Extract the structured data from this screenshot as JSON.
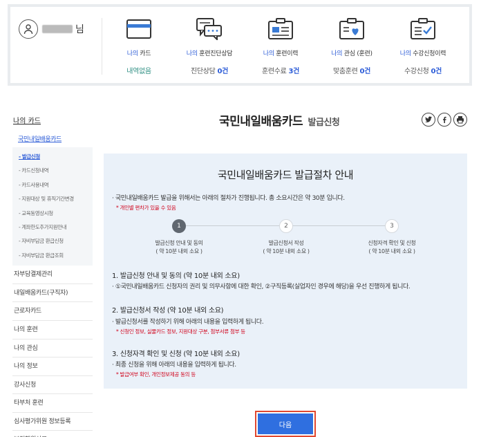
{
  "user": {
    "suffix": "님"
  },
  "stats": [
    {
      "prefix": "나의",
      "label": " 카드",
      "value": "내역없음",
      "num": "",
      "after": "",
      "icon": "card-icon"
    },
    {
      "prefix": "나의",
      "label": " 훈련진단상담",
      "value": "진단상담 ",
      "num": "0건",
      "after": "",
      "icon": "chat-icon"
    },
    {
      "prefix": "나의",
      "label": " 훈련이력",
      "value": "훈련수료 ",
      "num": "3건",
      "after": "",
      "icon": "history-icon"
    },
    {
      "prefix": "나의",
      "label": " 관심 (훈련)",
      "value": "맞춤훈련 ",
      "num": "0건",
      "after": "",
      "icon": "heart-folder-icon"
    },
    {
      "prefix": "나의",
      "label": " 수강신청이력",
      "value": "수강신청 ",
      "num": "0건",
      "after": "",
      "icon": "checklist-icon"
    }
  ],
  "sidebar": {
    "title": "나의 카드",
    "sub": "국민내일배움카드",
    "items": [
      "- 발급신청",
      "- 카드신청내역",
      "- 카드사용내역",
      "- 지원대상 및 휴직기간변경",
      "- 교육동영상시청",
      "- 계좌한도추가지원안내",
      "- 자비부담금 환급신청",
      "- 자비부담금 환급조회"
    ],
    "menus": [
      "자부담결제관리",
      "내일배움카드(구직자)",
      "근로자카드",
      "나의 훈련",
      "나의 관심",
      "나의 정보",
      "강사신청",
      "타부처 훈련",
      "심사평가위원 정보등록",
      "부정행위신고"
    ]
  },
  "page": {
    "title": "국민내일배움카드",
    "subtitle": "발급신청"
  },
  "panel": {
    "title": "국민내일배움카드 발급절차 안내",
    "notice": "· 국민내일배움카드 발급을 위해서는 아래의 절차가 진행됩니다. 총 소요시간은 약 30분 입니다.",
    "notice_red": "* 개인별 편차가 있을 수 있음",
    "steps": [
      {
        "num": "1",
        "label1": "발급신청 안내 및 동의",
        "label2": "( 약 10분 내외 소요 )"
      },
      {
        "num": "2",
        "label1": "발급신청서 작성",
        "label2": "( 약 10분 내외 소요 )"
      },
      {
        "num": "3",
        "label1": "신청자격 확인 및 신청",
        "label2": "( 약 10분 내외 소요 )"
      }
    ],
    "sections": [
      {
        "heading": "1. 발급신청 안내 및 동의 (약 10분 내외 소요)",
        "body": "· ①국민내일배움카드 신청자의 권리 및 의무사항에 대한 확인, ②구직등록(실업자인 경우에 해당)을 우선 진행하게 됩니다.",
        "red": ""
      },
      {
        "heading": "2. 발급신청서 작성 (약 10분 내외 소요)",
        "body": "· 발급신청서를 작성하기 위해 아래의 내용을 입력하게 됩니다.",
        "red": "* 신청인 정보, 실물카드 정보, 지원대상 구분, 첨부서류 첨부 등"
      },
      {
        "heading": "3. 신청자격 확인 및 신청 (약 10분 내외 소요)",
        "body": "· 최종 신청을 위해 아래의 내용을 입력하게 됩니다.",
        "red": "* 발급여부 확인, 개인정보제공 동의 등"
      }
    ]
  },
  "next_label": "다음"
}
